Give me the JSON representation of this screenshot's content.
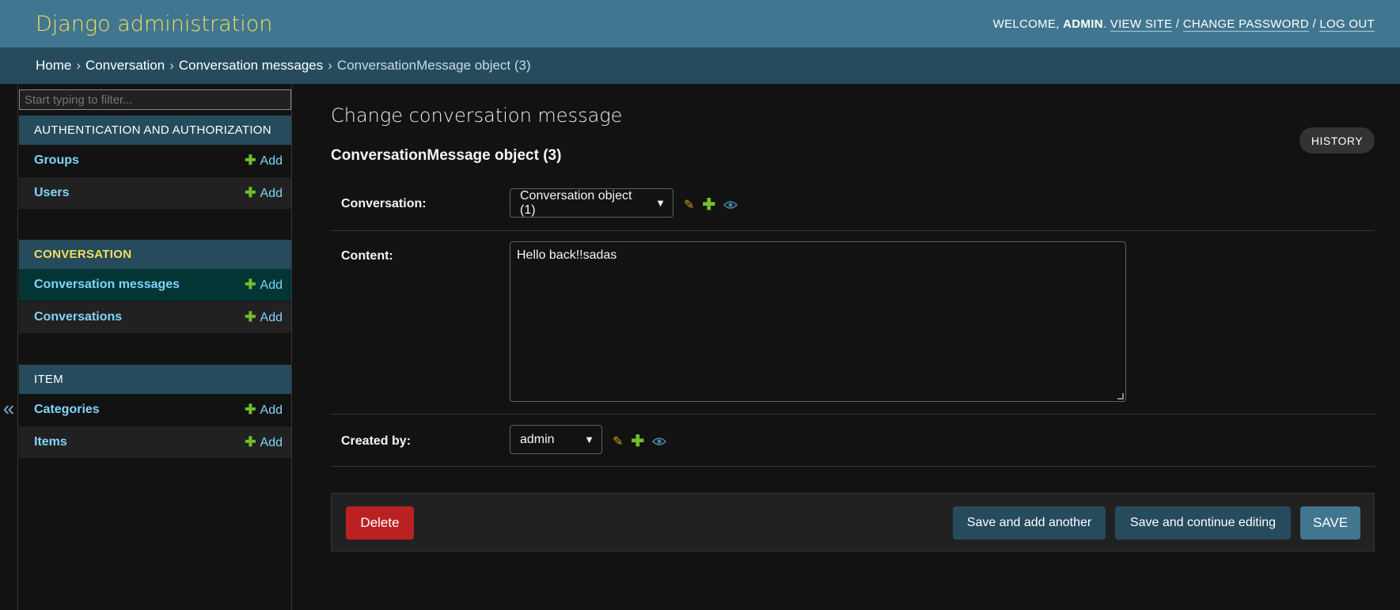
{
  "header": {
    "site_name": "Django administration",
    "welcome_prefix": "Welcome,",
    "username": "admin",
    "view_site": "View site",
    "change_password": "Change password",
    "log_out": "Log out",
    "separator": "/"
  },
  "breadcrumbs": {
    "home": "Home",
    "app": "Conversation",
    "model": "Conversation messages",
    "current": "ConversationMessage object (3)",
    "separator": "›"
  },
  "sidebar": {
    "filter_placeholder": "Start typing to filter...",
    "collapse_glyph": "«",
    "add_label": "Add",
    "apps": [
      {
        "caption": "Authentication and Authorization",
        "models": [
          {
            "name": "Groups"
          },
          {
            "name": "Users"
          }
        ]
      },
      {
        "caption": "Conversation",
        "current": true,
        "models": [
          {
            "name": "Conversation messages",
            "current": true
          },
          {
            "name": "Conversations"
          }
        ]
      },
      {
        "caption": "Item",
        "models": [
          {
            "name": "Categories"
          },
          {
            "name": "Items"
          }
        ]
      }
    ]
  },
  "main": {
    "page_title": "Change conversation message",
    "history_button": "History",
    "object_title": "ConversationMessage object (3)",
    "fields": {
      "conversation": {
        "label": "Conversation:",
        "value": "Conversation object (1)"
      },
      "content": {
        "label": "Content:",
        "value": "Hello back!!sadas"
      },
      "created_by": {
        "label": "Created by:",
        "value": "admin"
      }
    }
  },
  "submit_row": {
    "delete": "Delete",
    "save_add_another": "Save and add another",
    "save_continue": "Save and continue editing",
    "save": "Save"
  },
  "colors": {
    "header_bg": "#417690",
    "breadcrumbs_bg": "#264b5d",
    "accent_yellow": "#f5dd5d",
    "link_blue": "#81d4fa",
    "add_green": "#70bf2b",
    "delete_red": "#ba2121"
  },
  "icons": {
    "edit": "pencil-icon",
    "add": "plus-icon",
    "view": "eye-icon",
    "collapse": "double-chevron-left-icon"
  }
}
